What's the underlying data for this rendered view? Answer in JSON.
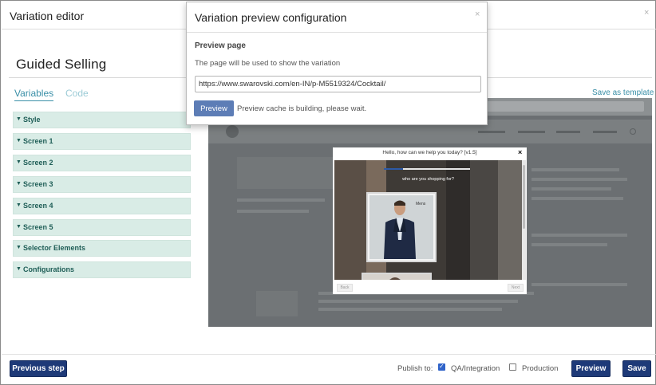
{
  "editor": {
    "title": "Variation editor",
    "close_icon": "×",
    "section_title": "Guided Selling",
    "tabs": [
      {
        "label": "Variables",
        "active": true
      },
      {
        "label": "Code",
        "active": false
      }
    ],
    "save_as_template": "Save as template",
    "accordion": [
      {
        "label": "Style"
      },
      {
        "label": "Screen 1"
      },
      {
        "label": "Screen 2"
      },
      {
        "label": "Screen 3"
      },
      {
        "label": "Screen 4"
      },
      {
        "label": "Screen 5"
      },
      {
        "label": "Selector Elements"
      },
      {
        "label": "Configurations"
      }
    ],
    "accordion_icon": "▼"
  },
  "preview_widget": {
    "title": "Hello, how can we help you today? [v1.5]",
    "close_icon": "×",
    "question": "who are you shopping for?",
    "card_label": "Mens",
    "progress": 0.22,
    "back_label": "Back",
    "next_label": "Next"
  },
  "modal": {
    "title": "Variation preview configuration",
    "close_icon": "×",
    "heading": "Preview page",
    "description": "The page will be used to show the variation",
    "url_value": "https://www.swarovski.com/en-IN/p-M5519324/Cocktail/",
    "preview_button": "Preview",
    "cache_message": "Preview cache is building, please wait."
  },
  "footer": {
    "previous_step": "Previous step",
    "publish_to": "Publish to:",
    "targets": [
      {
        "label": "QA/Integration",
        "checked": true
      },
      {
        "label": "Production",
        "checked": false
      }
    ],
    "preview_button": "Preview",
    "save_button": "Save"
  },
  "colors": {
    "accent": "#3a8fa7",
    "accordion_bg": "#d9ece6",
    "primary_button": "#1e3a78",
    "modal_button": "#5d7db6"
  }
}
